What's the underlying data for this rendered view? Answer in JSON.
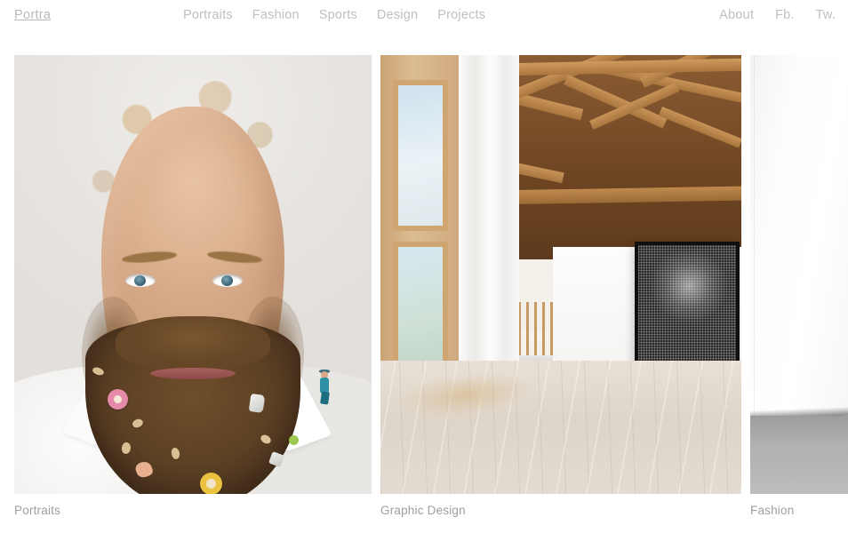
{
  "header": {
    "logo": "Portra",
    "nav_main": [
      {
        "label": "Portraits"
      },
      {
        "label": "Fashion"
      },
      {
        "label": "Sports"
      },
      {
        "label": "Design"
      },
      {
        "label": "Projects"
      }
    ],
    "nav_right": [
      {
        "label": "About"
      },
      {
        "label": "Fb."
      },
      {
        "label": "Tw."
      }
    ]
  },
  "gallery": {
    "items": [
      {
        "caption": "Portraits",
        "alt": "Close-up portrait of a bearded man with curly brown hair, small objects such as cereal rings and a tiny figurine tucked into his beard, light grey studio backdrop, white shirt"
      },
      {
        "caption": "Graphic Design",
        "alt": "Bright modern timber interior with exposed wooden roof trusses, tall windows with sheer white curtain, pale wooden floor, a large framed black halftone portrait on a white wall and a red chair in the hallway"
      },
      {
        "caption": "Fashion",
        "alt": "Minimal white studio wall meeting a grey concrete floor"
      }
    ]
  },
  "colors": {
    "page_background": "#ffffff",
    "nav_text": "#c0c0c0",
    "logo_text": "#b9b9b9",
    "caption_text": "#9e9e9e",
    "accent_red_chair": "#e8452a"
  }
}
